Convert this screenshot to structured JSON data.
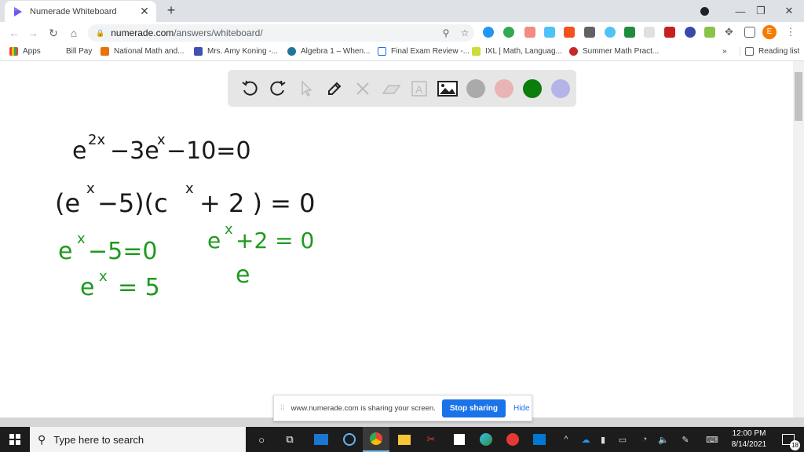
{
  "browser": {
    "tab_title": "Numerade Whiteboard",
    "new_tab_label": "+",
    "url_host": "numerade.com",
    "url_path": "/answers/whiteboard/",
    "profile_initial": "E"
  },
  "bookmarks": [
    {
      "label": "Apps",
      "icon": "apps-grid-icon",
      "color": "#ea4335"
    },
    {
      "label": "Bill Pay",
      "icon": "",
      "color": ""
    },
    {
      "label": "National Math and...",
      "icon": "national-math-icon",
      "color": "#e8710a"
    },
    {
      "label": "Mrs. Amy Koning -...",
      "icon": "google-sites-icon",
      "color": "#3f51b5"
    },
    {
      "label": "Algebra 1 – When...",
      "icon": "wordpress-icon",
      "color": "#21759b"
    },
    {
      "label": "Final Exam Review -...",
      "icon": "google-forms-icon",
      "color": "#1a73e8"
    },
    {
      "label": "IXL | Math, Languag...",
      "icon": "ixl-icon",
      "color": "#8bc34a"
    },
    {
      "label": "Summer Math Pract...",
      "icon": "summer-math-icon",
      "color": "#c62828"
    }
  ],
  "bookmarks_overflow": "»",
  "reading_list": "Reading list",
  "whiteboard": {
    "tools": [
      "undo",
      "redo",
      "select",
      "pen",
      "tools",
      "eraser",
      "text",
      "image"
    ],
    "colors": [
      "#aaaaaa",
      "#e8b4b4",
      "#0a7d0a",
      "#b4b4e8"
    ],
    "selected_color": "#0a7d0a",
    "ink_black": "#1a1a1a",
    "ink_green": "#1e9a1e",
    "lines": [
      {
        "text": "e^{2x} − 3e^{x} − 10 = 0",
        "color": "black"
      },
      {
        "text": "(e^{x} − 5)(e^{x} + 2) = 0",
        "color": "black"
      },
      {
        "text": "e^{x} − 5 = 0",
        "color": "green"
      },
      {
        "text": "e^{x} = 5",
        "color": "green"
      },
      {
        "text": "e^{x} + 2 = 0",
        "color": "green"
      },
      {
        "text": "e",
        "color": "green"
      }
    ]
  },
  "share_bar": {
    "message": "www.numerade.com is sharing your screen.",
    "stop_label": "Stop sharing",
    "hide_label": "Hide"
  },
  "taskbar": {
    "search_placeholder": "Type here to search",
    "time": "12:00 PM",
    "date": "8/14/2021",
    "notification_count": "18"
  }
}
